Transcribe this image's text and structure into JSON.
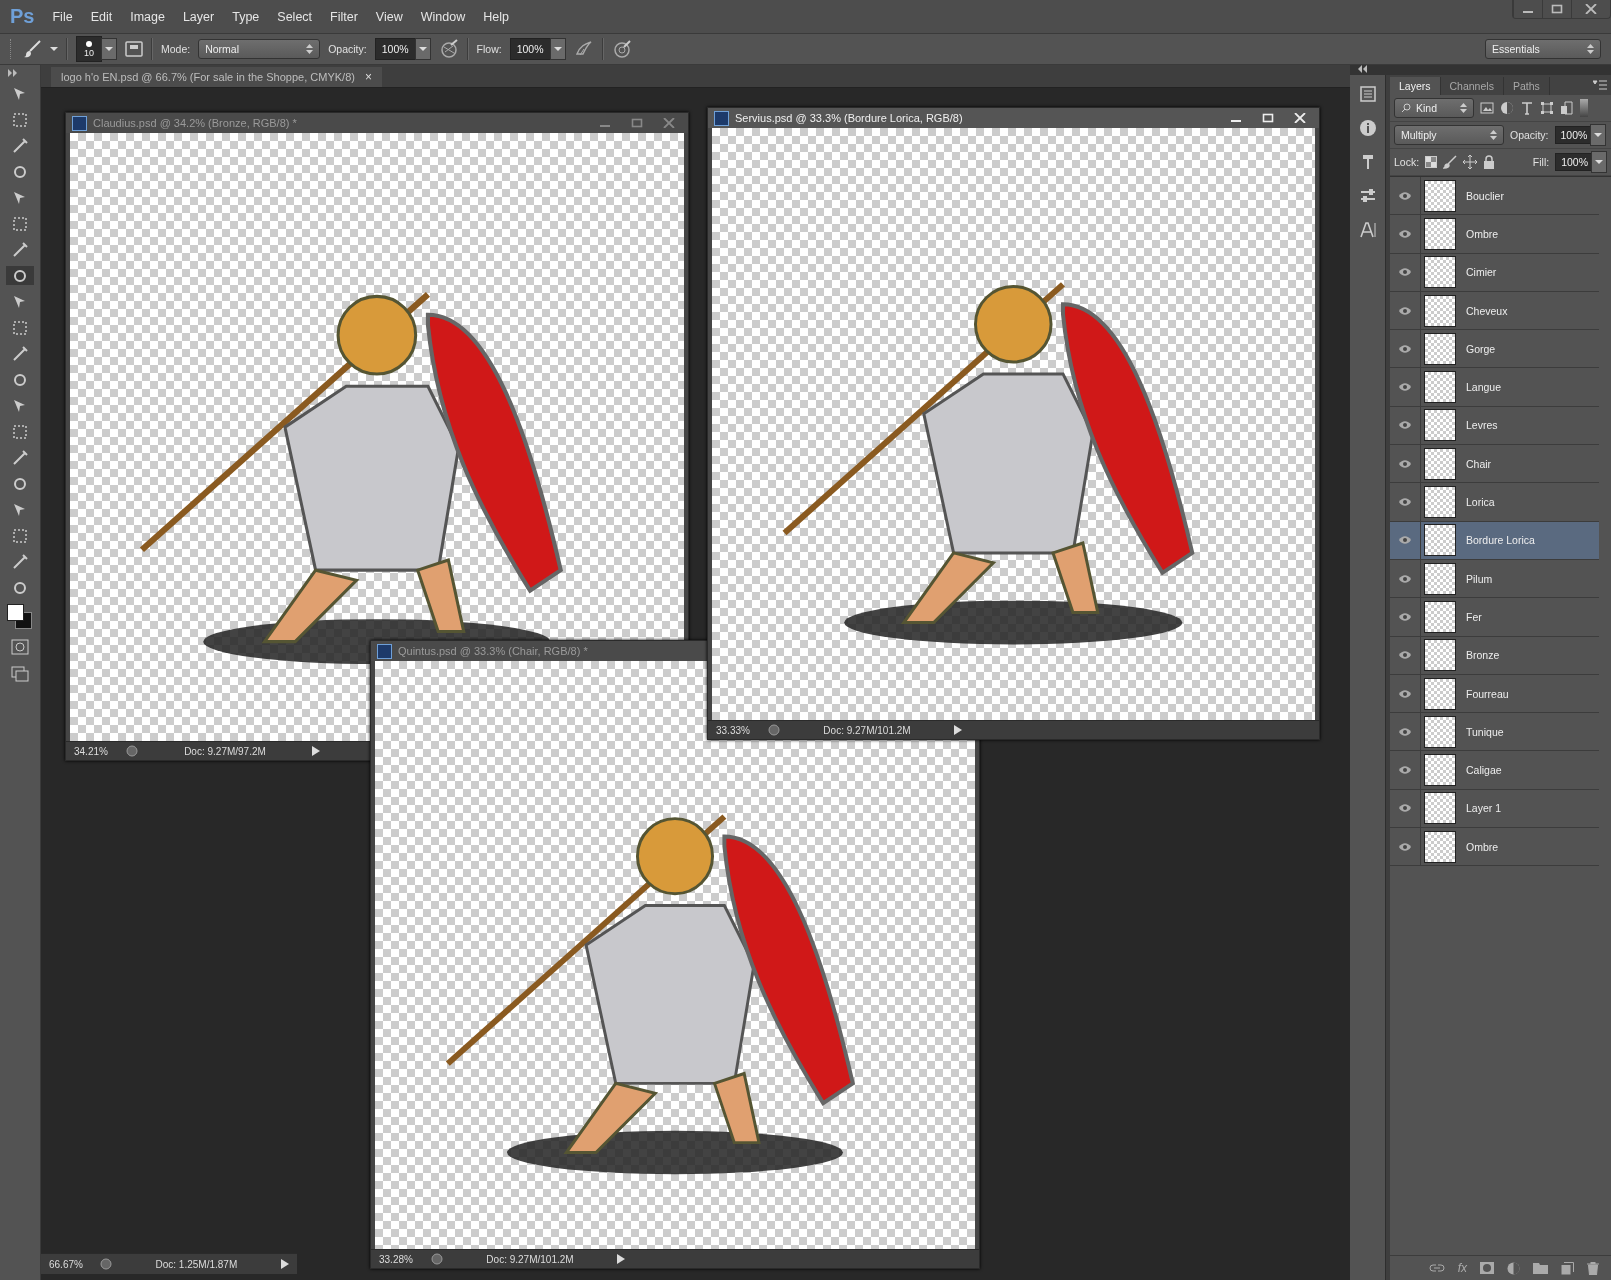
{
  "app_logo": "Ps",
  "menu": [
    "File",
    "Edit",
    "Image",
    "Layer",
    "Type",
    "Select",
    "Filter",
    "View",
    "Window",
    "Help"
  ],
  "options_bar": {
    "brush_size": "10",
    "mode_label": "Mode:",
    "mode": "Normal",
    "opacity_label": "Opacity:",
    "opacity": "100%",
    "flow_label": "Flow:",
    "flow": "100%",
    "workspace": "Essentials"
  },
  "document_tab": {
    "title": "logo h'o EN.psd @ 66.7% (For sale in the Shoppe, CMYK/8)",
    "close": "×"
  },
  "windows": [
    {
      "title": "Claudius.psd @ 34.2% (Bronze, RGB/8) *",
      "active": false,
      "zoom": "34.21%",
      "doc": "Doc: 9.27M/97.2M"
    },
    {
      "title": "Servius.psd @ 33.3% (Bordure Lorica, RGB/8)",
      "active": true,
      "zoom": "33.33%",
      "doc": "Doc: 9.27M/101.2M"
    },
    {
      "title": "Quintus.psd @ 33.3% (Chair, RGB/8) *",
      "active": false,
      "zoom": "33.28%",
      "doc": "Doc: 9.27M/101.2M"
    }
  ],
  "main_status": {
    "zoom": "66.67%",
    "doc": "Doc: 1.25M/1.87M"
  },
  "layers_panel": {
    "tabs": [
      {
        "label": "Layers",
        "selected": true
      },
      {
        "label": "Channels",
        "selected": false
      },
      {
        "label": "Paths",
        "selected": false
      }
    ],
    "filter": "Kind",
    "blend_mode": "Multiply",
    "opacity_label": "Opacity:",
    "opacity": "100%",
    "lock_label": "Lock:",
    "fill_label": "Fill:",
    "fill": "100%",
    "layers": [
      {
        "name": "Bouclier",
        "visible": true,
        "selected": false
      },
      {
        "name": "Ombre",
        "visible": true,
        "selected": false
      },
      {
        "name": "Cimier",
        "visible": true,
        "selected": false
      },
      {
        "name": "Cheveux",
        "visible": true,
        "selected": false
      },
      {
        "name": "Gorge",
        "visible": true,
        "selected": false
      },
      {
        "name": "Langue",
        "visible": true,
        "selected": false
      },
      {
        "name": "Levres",
        "visible": true,
        "selected": false
      },
      {
        "name": "Chair",
        "visible": true,
        "selected": false
      },
      {
        "name": "Lorica",
        "visible": true,
        "selected": false
      },
      {
        "name": "Bordure Lorica",
        "visible": true,
        "selected": true
      },
      {
        "name": "Pilum",
        "visible": true,
        "selected": false
      },
      {
        "name": "Fer",
        "visible": true,
        "selected": false
      },
      {
        "name": "Bronze",
        "visible": true,
        "selected": false
      },
      {
        "name": "Fourreau",
        "visible": true,
        "selected": false
      },
      {
        "name": "Tunique",
        "visible": true,
        "selected": false
      },
      {
        "name": "Caligae",
        "visible": true,
        "selected": false
      },
      {
        "name": "Layer 1",
        "visible": true,
        "selected": false
      },
      {
        "name": "Ombre",
        "visible": true,
        "selected": false
      }
    ],
    "fx_label": "fx"
  }
}
